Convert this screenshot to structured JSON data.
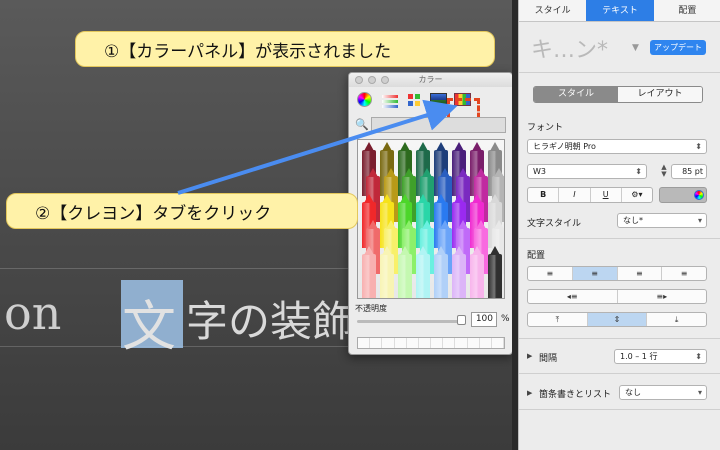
{
  "canvas": {
    "slide_latin": "on",
    "selected_char": "文",
    "slide_rest": "字の装飾"
  },
  "callouts": {
    "step1": "①【カラーパネル】が表示されました",
    "step2": "②【クレヨン】タブをクリック"
  },
  "color_panel": {
    "title": "カラー",
    "opacity_label": "不透明度",
    "opacity_value": "100",
    "opacity_unit": "%",
    "crayon_colors": [
      "#7a1e2e",
      "#7a6a12",
      "#2d6a1e",
      "#1e6a4a",
      "#1e3e7a",
      "#4a1e7a",
      "#7a1e6a",
      "#8a8a8a",
      "#c0283a",
      "#b89a18",
      "#3fa02a",
      "#20a070",
      "#2a5ec0",
      "#7a2ac0",
      "#c02aa0",
      "#b4b4b4",
      "#f0282a",
      "#f6e21a",
      "#4cd62a",
      "#2ad6a8",
      "#2a7af0",
      "#9a2af0",
      "#f02ad0",
      "#d8d8d8",
      "#f06a6a",
      "#f8f06a",
      "#8cf06a",
      "#6af0e0",
      "#6aa4f8",
      "#c06af8",
      "#f86ae0",
      "#e8e8e8",
      "#f8b0b0",
      "#f8f4b4",
      "#c4f8b0",
      "#b0f4f4",
      "#b0d0f8",
      "#dcb4f8",
      "#f8b4ec",
      "#303030"
    ]
  },
  "inspector": {
    "tabs": [
      "スタイル",
      "テキスト",
      "配置"
    ],
    "style_name": "キ…ン*",
    "update_button": "アップデート",
    "segments": [
      "スタイル",
      "レイアウト"
    ],
    "font_label": "フォント",
    "font_family": "ヒラギノ明朝 Pro",
    "font_weight": "W3",
    "font_size": "85 pt",
    "format_buttons": [
      "B",
      "I",
      "U",
      "⚙▾"
    ],
    "char_style_label": "文字スタイル",
    "char_style_value": "なし*",
    "alignment_label": "配置",
    "align_buttons": [
      "≡",
      "≡",
      "≡",
      "≡"
    ],
    "indent_buttons": [
      "◂≡",
      "≡▸"
    ],
    "valign_buttons": [
      "⤒",
      "⇕",
      "⤓"
    ],
    "spacing_label": "間隔",
    "spacing_value": "1.0 – 1 行",
    "list_label": "箇条書きとリスト",
    "list_value": "なし"
  },
  "accent": {
    "blue": "#2d7ee6",
    "highlight": "#e3451f",
    "callout": "#fff2a8"
  }
}
